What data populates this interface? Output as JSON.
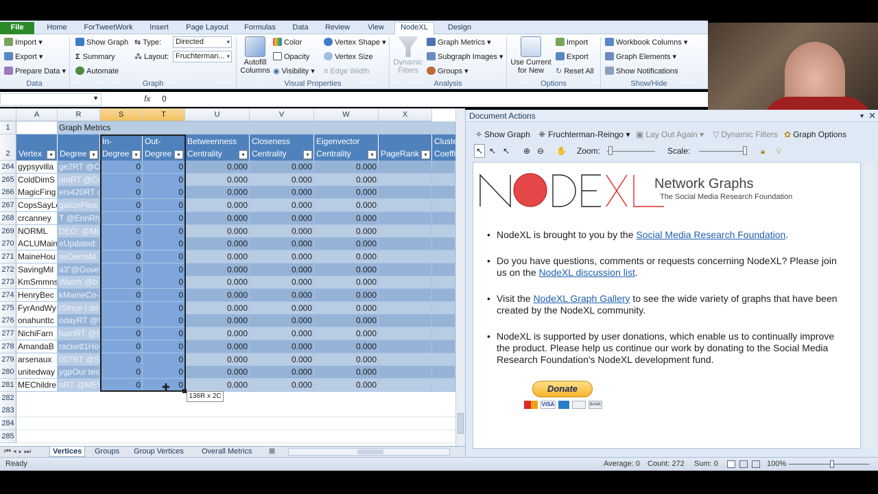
{
  "tabs": [
    "File",
    "Home",
    "ForTweetWork",
    "Insert",
    "Page Layout",
    "Formulas",
    "Data",
    "Review",
    "View",
    "NodeXL",
    "Design"
  ],
  "ribbon": {
    "data": {
      "import": "Import",
      "export": "Export",
      "prepare": "Prepare Data",
      "label": "Data"
    },
    "graph": {
      "show_graph": "Show Graph",
      "summary": "Summary",
      "automate": "Automate",
      "type_label": "Type:",
      "type_value": "Directed",
      "layout_label": "Layout:",
      "layout_value": "Fruchterman...",
      "label": "Graph"
    },
    "visual": {
      "autofill": "Autofill Columns",
      "color": "Color",
      "opacity": "Opacity",
      "visibility": "Visibility",
      "vertex_shape": "Vertex Shape",
      "vertex_size": "Vertex Size",
      "edge_width": "Edge Width",
      "label": "Visual Properties"
    },
    "analysis": {
      "dynamic_filters": "Dynamic Filters",
      "graph_metrics": "Graph Metrics",
      "subgraph": "Subgraph Images",
      "groups": "Groups",
      "label": "Analysis"
    },
    "options": {
      "use_current": "Use Current for New",
      "import": "Import",
      "export": "Export",
      "reset": "Reset All",
      "label": "Options"
    },
    "showhide": {
      "workbook_columns": "Workbook Columns",
      "graph_elements": "Graph Elements",
      "show_notifications": "Show Notifications",
      "label": "Show/Hide"
    }
  },
  "formula": {
    "fx": "fx",
    "value": "0"
  },
  "grid": {
    "columns": [
      "A",
      "R",
      "S",
      "T",
      "U",
      "V",
      "W",
      "X"
    ],
    "group_title": "Graph Metrics",
    "headers": [
      "Vertex",
      "Degree",
      "In-\nDegree",
      "Out-\nDegree",
      "Betweenness\nCentrality",
      "Closeness\nCentrality",
      "Eigenvector\nCentrality",
      "PageRank",
      "Cluste\nCoeffi"
    ],
    "rows": [
      {
        "n": "264",
        "a": "gypsyvilla",
        "r": "ge2RT @Co",
        "s": "0",
        "t": "0",
        "u": "0.000",
        "v": "0.000",
        "w": "0.000"
      },
      {
        "n": "265",
        "a": "ColdDimS",
        "r": "umRT @Co",
        "s": "0",
        "t": "0",
        "u": "0.000",
        "v": "0.000",
        "w": "0.000"
      },
      {
        "n": "266",
        "a": "MagicFing",
        "r": "ers420RT @",
        "s": "0",
        "t": "0",
        "u": "0.000",
        "v": "0.000",
        "w": "0.000"
      },
      {
        "n": "267",
        "a": "CopsSayLe",
        "r": "galizePlea",
        "s": "0",
        "t": "0",
        "u": "0.000",
        "v": "0.000",
        "w": "0.000"
      },
      {
        "n": "268",
        "a": "crcanney",
        "r": "T @ErinRh",
        "s": "0",
        "t": "0",
        "u": "0.000",
        "v": "0.000",
        "w": "0.000"
      },
      {
        "n": "269",
        "a": "NORML",
        "r": "DEO: @Mis",
        "s": "0",
        "t": "0",
        "u": "0.000",
        "v": "0.000",
        "w": "0.000"
      },
      {
        "n": "270",
        "a": "ACLUMaine",
        "r": "eUpdated:",
        "s": "0",
        "t": "0",
        "u": "0.000",
        "v": "0.000",
        "w": "0.000"
      },
      {
        "n": "271",
        "a": "MaineHou",
        "r": "seDemsM",
        "s": "0",
        "t": "0",
        "u": "0.000",
        "v": "0.000",
        "w": "0.000"
      },
      {
        "n": "272",
        "a": "SavingMil",
        "r": "a3\"@Gove",
        "s": "0",
        "t": "0",
        "u": "0.000",
        "v": "0.000",
        "w": "0.000"
      },
      {
        "n": "273",
        "a": "KmSmmns",
        "r": "Watch @b",
        "s": "0",
        "t": "0",
        "u": "0.000",
        "v": "0.000",
        "w": "0.000"
      },
      {
        "n": "274",
        "a": "HenryBec",
        "r": "kMaineCo-",
        "s": "0",
        "t": "0",
        "u": "0.000",
        "v": "0.000",
        "w": "0.000"
      },
      {
        "n": "275",
        "a": "FyrAndWy",
        "r": "rSince I do",
        "s": "0",
        "t": "0",
        "u": "0.000",
        "v": "0.000",
        "w": "0.000"
      },
      {
        "n": "276",
        "a": "onahunttc",
        "r": "odayRT @W",
        "s": "0",
        "t": "0",
        "u": "0.000",
        "v": "0.000",
        "w": "0.000"
      },
      {
        "n": "277",
        "a": "NichiFarn",
        "r": "hamRT @S",
        "s": "0",
        "t": "0",
        "u": "0.000",
        "v": "0.000",
        "w": "0.000"
      },
      {
        "n": "278",
        "a": "AmandaB",
        "r": "rackett1Ho",
        "s": "0",
        "t": "0",
        "u": "0.000",
        "v": "0.000",
        "w": "0.000"
      },
      {
        "n": "279",
        "a": "arsenaux",
        "r": "007RT @Se",
        "s": "0",
        "t": "0",
        "u": "0.000",
        "v": "0.000",
        "w": "0.000"
      },
      {
        "n": "280",
        "a": "unitedway",
        "r": "ygpOur tes",
        "s": "0",
        "t": "0",
        "u": "0.000",
        "v": "0.000",
        "w": "0.000"
      },
      {
        "n": "281",
        "a": "MEChildre",
        "r": "nRT @MEV",
        "s": "0",
        "t": "0",
        "u": "0.000",
        "v": "0.000",
        "w": "0.000"
      }
    ],
    "empty_rows": [
      "282",
      "283",
      "284",
      "285"
    ],
    "row_labels": [
      "1",
      "2"
    ],
    "tooltip": "136R x 2C"
  },
  "sheets": [
    "Vertices",
    "Groups",
    "Group Vertices",
    "Overall Metrics"
  ],
  "status": {
    "ready": "Ready",
    "average": "Average: 0",
    "count": "Count: 272",
    "sum": "Sum: 0",
    "zoom": "100%"
  },
  "doc": {
    "title": "Document Actions",
    "show_graph": "Show Graph",
    "layout": "Fruchterman-Reingo",
    "lay_out_again": "Lay Out Again",
    "dynamic_filters": "Dynamic Filters",
    "graph_options": "Graph Options",
    "zoom": "Zoom:",
    "scale": "Scale:",
    "logo_text": "NODEXL",
    "logo_title": "Network Graphs",
    "logo_sub": "The Social Media Research Foundation",
    "b1_pre": "NodeXL is brought to you by the ",
    "b1_link": "Social Media Research Foundation",
    "b1_post": ".",
    "b2_pre": "Do you have questions, comments or requests concerning NodeXL? Please join us on the ",
    "b2_link": "NodeXL discussion list",
    "b2_post": ".",
    "b3_pre": "Visit the ",
    "b3_link": "NodeXL Graph Gallery",
    "b3_post": " to see the wide variety of graphs that have been created by the NodeXL community.",
    "b4": "NodeXL is supported by user donations, which enable us to continually improve the product. Please help us continue our work by donating to the Social Media Research Foundation's NodeXL development fund.",
    "donate": "Donate",
    "cards": [
      "VISA",
      "BANK"
    ]
  },
  "colors": {
    "header_blue": "#4f81bd",
    "band_dark": "#95b3d7",
    "band_light": "#b8cce4",
    "selected": "#7ea6da",
    "donate": "#f8c23a"
  }
}
